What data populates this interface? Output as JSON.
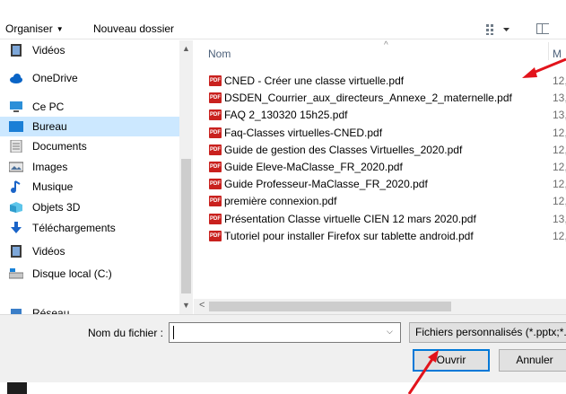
{
  "toolbar": {
    "organize_label": "Organiser",
    "organize_caret": "▼",
    "new_folder_label": "Nouveau dossier",
    "view_caret": "▼"
  },
  "nav": {
    "items": [
      {
        "label": "Vidéos",
        "icon": "video-folder-icon"
      },
      {
        "label": "OneDrive",
        "icon": "cloud-icon"
      },
      {
        "label": "Ce PC",
        "icon": "computer-icon"
      },
      {
        "label": "Bureau",
        "icon": "desktop-folder-icon",
        "selected": true
      },
      {
        "label": "Documents",
        "icon": "documents-folder-icon"
      },
      {
        "label": "Images",
        "icon": "images-folder-icon"
      },
      {
        "label": "Musique",
        "icon": "music-icon"
      },
      {
        "label": "Objets 3D",
        "icon": "3d-objects-icon"
      },
      {
        "label": "Téléchargements",
        "icon": "download-icon"
      },
      {
        "label": "Vidéos",
        "icon": "video-folder-icon"
      },
      {
        "label": "Disque local (C:)",
        "icon": "drive-icon"
      },
      {
        "label": "Réseau",
        "icon": "network-icon"
      }
    ],
    "scroll_up": "▲",
    "scroll_down": "▼"
  },
  "filelist": {
    "column_name": "Nom",
    "column_modified": "M",
    "sort_indicator": "^",
    "files": [
      {
        "name": "CNED - Créer une classe virtuelle.pdf",
        "date": "12,"
      },
      {
        "name": "DSDEN_Courrier_aux_directeurs_Annexe_2_maternelle.pdf",
        "date": "13,"
      },
      {
        "name": "FAQ 2_130320 15h25.pdf",
        "date": "13,"
      },
      {
        "name": "Faq-Classes virtuelles-CNED.pdf",
        "date": "12,"
      },
      {
        "name": "Guide de gestion des Classes Virtuelles_2020.pdf",
        "date": "12,"
      },
      {
        "name": "Guide Eleve-MaClasse_FR_2020.pdf",
        "date": "12,"
      },
      {
        "name": "Guide Professeur-MaClasse_FR_2020.pdf",
        "date": "12,"
      },
      {
        "name": "première connexion.pdf",
        "date": "12,"
      },
      {
        "name": "Présentation Classe virtuelle CIEN 12 mars 2020.pdf",
        "date": "13,"
      },
      {
        "name": "Tutoriel pour installer Firefox sur tablette android.pdf",
        "date": "12,"
      }
    ],
    "pdf_badge": "PDF",
    "hscroll_left": "<"
  },
  "bottom": {
    "filename_label": "Nom du fichier :",
    "filename_value": "",
    "filename_dropdown": "⌵",
    "filetype_value": "Fichiers personnalisés (*.pptx;*.",
    "open_label": "Ouvrir",
    "cancel_label": "Annuler"
  },
  "colors": {
    "selection": "#cce8ff",
    "accent": "#0078d7",
    "annotation_arrow": "#e2131b",
    "pdf_icon": "#c9211e"
  }
}
